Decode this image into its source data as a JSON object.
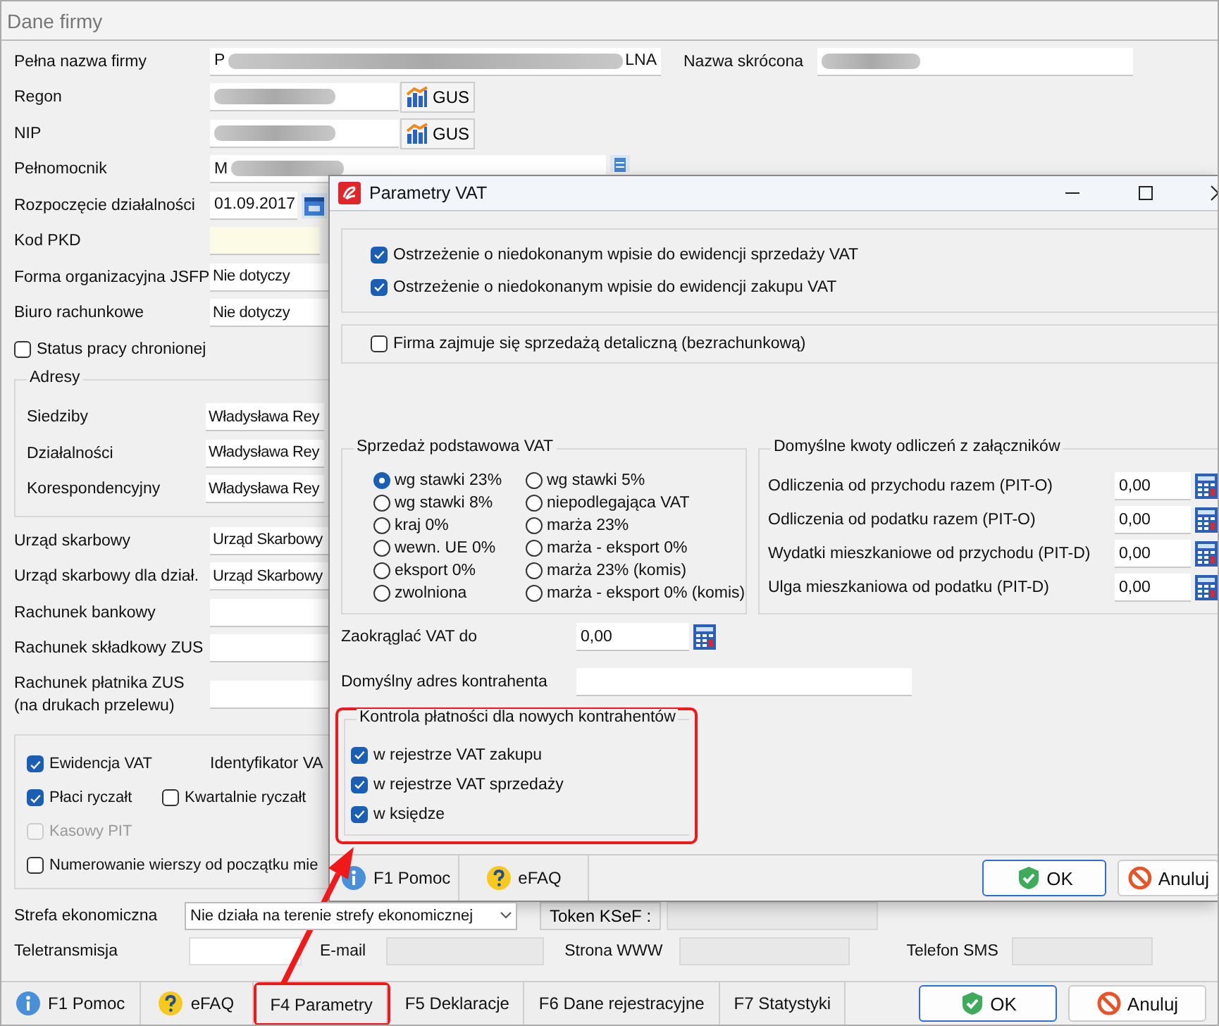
{
  "window": {
    "title": "Dane  firmy"
  },
  "company_name": {
    "label": "Pełna nazwa firmy",
    "prefix": "P",
    "suffix": "LNA"
  },
  "short_name": {
    "label": "Nazwa skrócona"
  },
  "id_fields": [
    {
      "label": "Regon",
      "button": "GUS"
    },
    {
      "label": "NIP",
      "button": "GUS"
    }
  ],
  "proxy": {
    "label": "Pełnomocnik",
    "prefix": "M"
  },
  "start_date": {
    "label": "Rozpoczęcie działalności",
    "value": "01.09.2017"
  },
  "pkd": {
    "label": "Kod PKD"
  },
  "form_fields": [
    {
      "label": "Forma organizacyjna JSFP",
      "value": "Nie dotyczy"
    },
    {
      "label": "Biuro rachunkowe",
      "value": "Nie dotyczy"
    }
  ],
  "status_check": {
    "label": "Status pracy chronionej",
    "checked": false
  },
  "addresses": {
    "title": "Adresy",
    "rows": [
      {
        "label": "Siedziby",
        "value": "Władysława Rey"
      },
      {
        "label": "Działalności",
        "value": "Władysława Rey"
      },
      {
        "label": "Korespondencyjny",
        "value": "Władysława Rey"
      }
    ]
  },
  "office_fields": [
    {
      "label": "Urząd skarbowy",
      "value": "Urząd Skarbowy"
    },
    {
      "label": "Urząd skarbowy dla dział.",
      "value": "Urząd Skarbowy"
    }
  ],
  "accounts": [
    {
      "label": "Rachunek bankowy"
    },
    {
      "label": "Rachunek składkowy ZUS"
    },
    {
      "label": "Rachunek płatnika ZUS\n(na drukach przelewu)"
    }
  ],
  "vat_group": {
    "vat_id_label": "Identyfikator VA",
    "options": [
      {
        "label": "Ewidencja VAT",
        "checked": true,
        "disabled": false
      },
      {
        "label": "Płaci ryczałt",
        "checked": true,
        "disabled": false
      },
      {
        "label": "Kwartalnie ryczałt",
        "checked": false,
        "disabled": false
      },
      {
        "label": "Kasowy PIT",
        "checked": false,
        "disabled": true
      },
      {
        "label": "Numerowanie wierszy od początku mie",
        "checked": false,
        "disabled": false
      }
    ]
  },
  "zone": {
    "label": "Strefa ekonomiczna",
    "value": "Nie działa na terenie strefy ekonomicznej",
    "button": "Token KSeF :"
  },
  "contacts": [
    {
      "label": "Teletransmisja"
    },
    {
      "label": "E-mail"
    },
    {
      "label": "Strona WWW"
    },
    {
      "label": "Telefon SMS"
    }
  ],
  "bottom_bar": [
    {
      "label": "F1 Pomoc",
      "kind": "info",
      "highlighted": false
    },
    {
      "label": "eFAQ",
      "kind": "faq",
      "highlighted": false
    },
    {
      "label": "F4 Parametry",
      "kind": "plain",
      "highlighted": true
    },
    {
      "label": "F5 Deklaracje",
      "kind": "plain",
      "highlighted": false
    },
    {
      "label": "F6 Dane rejestracyjne",
      "kind": "plain",
      "highlighted": false
    },
    {
      "label": "F7 Statystyki",
      "kind": "plain",
      "highlighted": false
    }
  ],
  "actions": [
    {
      "label": "OK",
      "kind": "ok"
    },
    {
      "label": "Anuluj",
      "kind": "cancel"
    }
  ],
  "dialog": {
    "title": "Parametry VAT",
    "warnings": [
      {
        "label": "Ostrzeżenie o niedokonanym wpisie do ewidencji sprzedaży VAT",
        "checked": true
      },
      {
        "label": "Ostrzeżenie o niedokonanym wpisie do ewidencji zakupu VAT",
        "checked": true
      }
    ],
    "retail": {
      "label": "Firma zajmuje się sprzedażą detaliczną (bezrachunkową)",
      "checked": false
    },
    "sales": {
      "title": "Sprzedaż podstawowa VAT",
      "options": [
        {
          "label": "wg stawki 23%",
          "selected": true
        },
        {
          "label": "wg stawki 8%",
          "selected": false
        },
        {
          "label": "kraj 0%",
          "selected": false
        },
        {
          "label": "wewn. UE 0%",
          "selected": false
        },
        {
          "label": "eksport 0%",
          "selected": false
        },
        {
          "label": "zwolniona",
          "selected": false
        },
        {
          "label": "wg stawki 5%",
          "selected": false
        },
        {
          "label": "niepodlegająca VAT",
          "selected": false
        },
        {
          "label": "marża 23%",
          "selected": false
        },
        {
          "label": "marża - eksport 0%",
          "selected": false
        },
        {
          "label": "marża 23% (komis)",
          "selected": false
        },
        {
          "label": "marża - eksport 0% (komis)",
          "selected": false
        }
      ]
    },
    "deductions": {
      "title": "Domyślne kwoty odliczeń z załączników",
      "rows": [
        {
          "label": "Odliczenia od przychodu razem (PIT-O)",
          "value": "0,00"
        },
        {
          "label": "Odliczenia od podatku razem (PIT-O)",
          "value": "0,00"
        },
        {
          "label": "Wydatki mieszkaniowe od przychodu (PIT-D)",
          "value": "0,00"
        },
        {
          "label": "Ulga mieszkaniowa od podatku (PIT-D)",
          "value": "0,00"
        }
      ]
    },
    "rounding": {
      "label": "Zaokrąglać VAT do",
      "value": "0,00"
    },
    "default_address": {
      "label": "Domyślny adres kontrahenta"
    },
    "payment_control": {
      "title": "Kontrola płatności dla nowych kontrahentów",
      "highlighted": true,
      "options": [
        {
          "label": "w rejestrze VAT zakupu",
          "checked": true
        },
        {
          "label": "w rejestrze VAT sprzedaży",
          "checked": true
        },
        {
          "label": "w księdze",
          "checked": true
        }
      ]
    },
    "buttons": [
      {
        "label": "F1 Pomoc",
        "kind": "info"
      },
      {
        "label": "eFAQ",
        "kind": "faq"
      },
      {
        "label": "OK",
        "kind": "ok"
      },
      {
        "label": "Anuluj",
        "kind": "cancel"
      }
    ]
  }
}
